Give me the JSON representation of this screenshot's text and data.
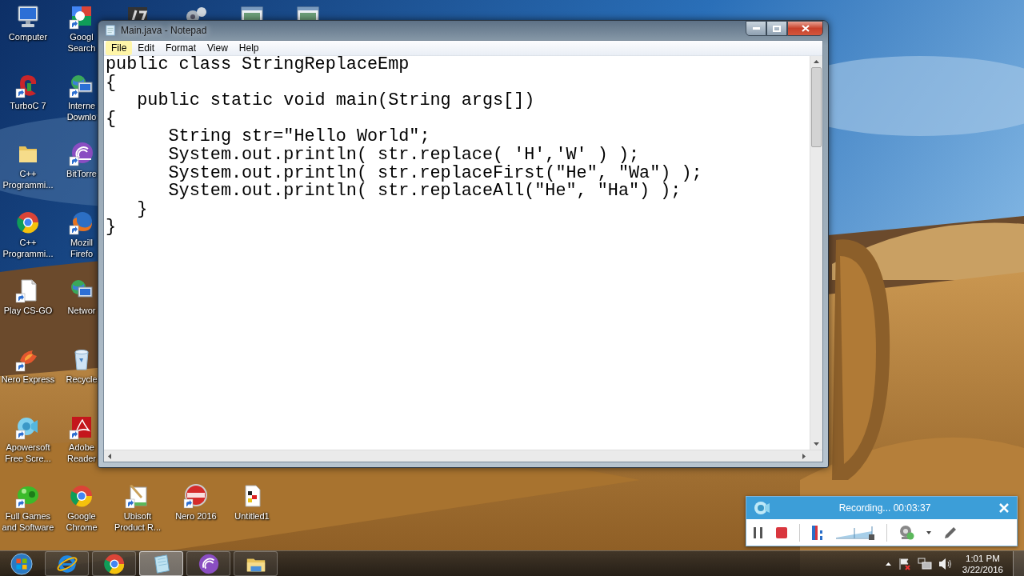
{
  "desktop": {
    "icon_columns": [
      [
        {
          "kind": "computer",
          "lines": [
            "Computer"
          ]
        },
        {
          "kind": "turbo",
          "lines": [
            "TurboC 7"
          ]
        },
        {
          "kind": "folder",
          "lines": [
            "C++",
            "Programmi..."
          ]
        },
        {
          "kind": "chrome",
          "lines": [
            "C++",
            "Programmi..."
          ]
        },
        {
          "kind": "file",
          "lines": [
            "Play CS-GO"
          ]
        },
        {
          "kind": "nero",
          "lines": [
            "Nero Express"
          ]
        },
        {
          "kind": "apowersoft",
          "lines": [
            "Apowersoft",
            "Free Scre..."
          ]
        },
        {
          "kind": "games",
          "lines": [
            "Full Games",
            "and Software"
          ]
        }
      ],
      [
        {
          "kind": "google",
          "lines": [
            "Googl",
            "Search"
          ]
        },
        {
          "kind": "idm",
          "lines": [
            "Interne",
            "Downlo"
          ]
        },
        {
          "kind": "bittorrent",
          "lines": [
            "BitTorre"
          ]
        },
        {
          "kind": "firefox",
          "lines": [
            "Mozill",
            "Firefo"
          ]
        },
        {
          "kind": "network",
          "lines": [
            "Networ"
          ]
        },
        {
          "kind": "recycle",
          "lines": [
            "Recycle"
          ]
        },
        {
          "kind": "adobe",
          "lines": [
            "Adobe",
            "Reader"
          ]
        },
        {
          "kind": "chrome",
          "lines": [
            "Google",
            "Chrome"
          ]
        }
      ]
    ],
    "top_partial_icons": [
      {
        "kind": "turbo7"
      },
      {
        "kind": "cogs"
      },
      {
        "kind": "window"
      },
      {
        "kind": "window"
      }
    ],
    "bottom_row_icons": [
      {
        "kind": "ubisoft",
        "lines": [
          "Ubisoft",
          "Product R..."
        ]
      },
      {
        "kind": "nero2016",
        "lines": [
          "Nero 2016"
        ]
      },
      {
        "kind": "untitled",
        "lines": [
          "Untitled1"
        ]
      }
    ]
  },
  "notepad": {
    "title": "Main.java - Notepad",
    "menu": [
      {
        "label": "File",
        "selected": true
      },
      {
        "label": "Edit",
        "selected": false
      },
      {
        "label": "Format",
        "selected": false
      },
      {
        "label": "View",
        "selected": false
      },
      {
        "label": "Help",
        "selected": false
      }
    ],
    "lines": [
      "public class StringReplaceEmp",
      "{",
      "   public static void main(String args[])",
      "{",
      "      String str=\"Hello World\";",
      "      System.out.println( str.replace( 'H','W' ) );",
      "      System.out.println( str.replaceFirst(\"He\", \"Wa\") );",
      "      System.out.println( str.replaceAll(\"He\", \"Ha\") );",
      "   }",
      "}"
    ]
  },
  "recorder": {
    "title": "Recording... 00:03:37",
    "tools": [
      {
        "kind": "pause"
      },
      {
        "kind": "stop"
      },
      {
        "kind": "divider"
      },
      {
        "kind": "bars"
      },
      {
        "kind": "meter"
      },
      {
        "kind": "divider"
      },
      {
        "kind": "webcam"
      },
      {
        "kind": "caret"
      },
      {
        "kind": "pencil"
      }
    ]
  },
  "taskbar": {
    "items": [
      {
        "kind": "start",
        "selected": false
      },
      {
        "kind": "ie",
        "selected": false
      },
      {
        "kind": "chrome",
        "selected": false
      },
      {
        "kind": "notepad",
        "selected": true
      },
      {
        "kind": "bittorrent",
        "selected": false
      },
      {
        "kind": "explorer",
        "selected": false
      }
    ],
    "tray": {
      "icons": [
        {
          "kind": "arrow"
        },
        {
          "kind": "flag"
        },
        {
          "kind": "network"
        },
        {
          "kind": "volume"
        }
      ],
      "time": "1:01 PM",
      "date": "3/22/2016"
    }
  }
}
